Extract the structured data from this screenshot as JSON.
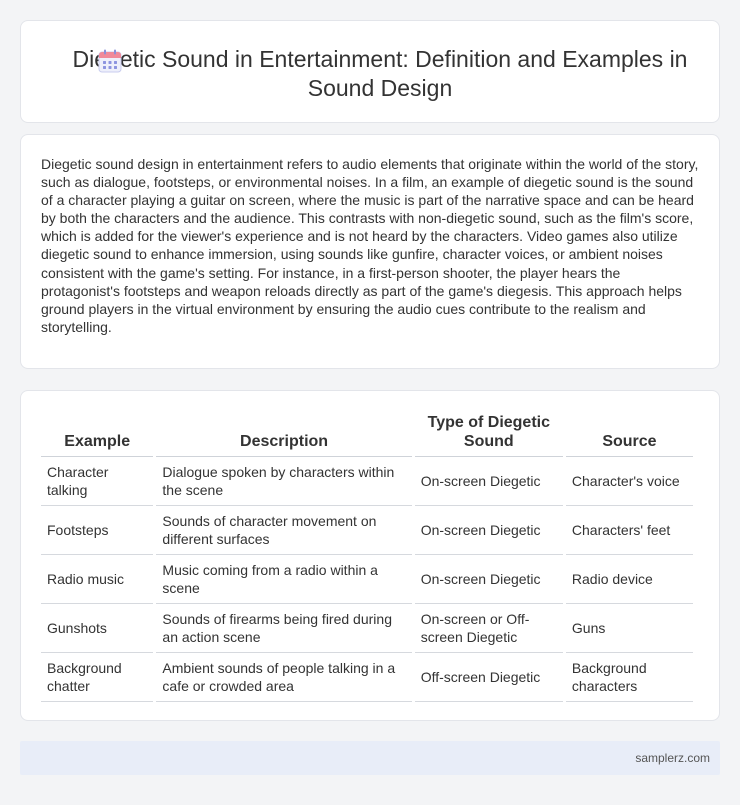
{
  "header": {
    "icon": "calendar-icon",
    "title": "Diegetic Sound in Entertainment: Definition and Examples in Sound Design"
  },
  "intro": {
    "text": "Diegetic sound design in entertainment refers to audio elements that originate within the world of the story, such as dialogue, footsteps, or environmental noises. In a film, an example of diegetic sound is the sound of a character playing a guitar on screen, where the music is part of the narrative space and can be heard by both the characters and the audience. This contrasts with non-diegetic sound, such as the film's score, which is added for the viewer's experience and is not heard by the characters. Video games also utilize diegetic sound to enhance immersion, using sounds like gunfire, character voices, or ambient noises consistent with the game's setting. For instance, in a first-person shooter, the player hears the protagonist's footsteps and weapon reloads directly as part of the game's diegesis. This approach helps ground players in the virtual environment by ensuring the audio cues contribute to the realism and storytelling."
  },
  "table": {
    "headers": [
      "Example",
      "Description",
      "Type of Diegetic Sound",
      "Source"
    ],
    "rows": [
      [
        "Character talking",
        "Dialogue spoken by characters within the scene",
        "On-screen Diegetic",
        "Character's voice"
      ],
      [
        "Footsteps",
        "Sounds of character movement on different surfaces",
        "On-screen Diegetic",
        "Characters' feet"
      ],
      [
        "Radio music",
        "Music coming from a radio within a scene",
        "On-screen Diegetic",
        "Radio device"
      ],
      [
        "Gunshots",
        "Sounds of firearms being fired during an action scene",
        "On-screen or Off-screen Diegetic",
        "Guns"
      ],
      [
        "Background chatter",
        "Ambient sounds of people talking in a cafe or crowded area",
        "Off-screen Diegetic",
        "Background characters"
      ]
    ]
  },
  "footer": {
    "site": "samplerz.com"
  }
}
